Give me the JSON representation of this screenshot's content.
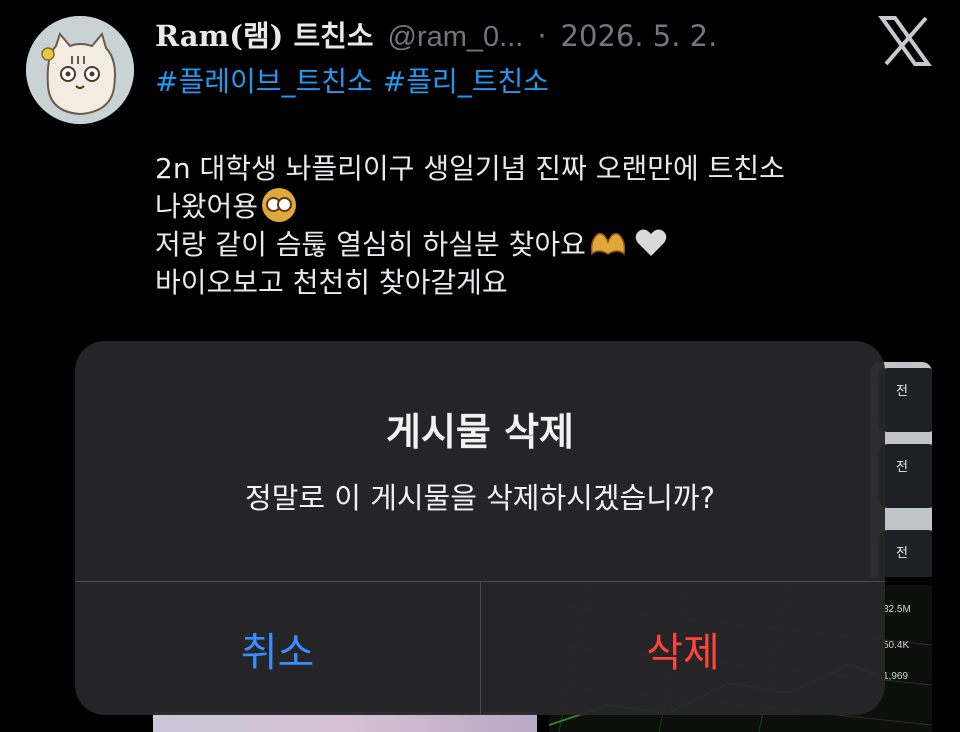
{
  "post": {
    "author_name": "Ram(램) 트친소",
    "handle": "@ram_0...",
    "separator": "·",
    "date": "2026. 5. 2.",
    "hashtags": [
      "#플레이브_트친소",
      "#플리_트친소"
    ],
    "body_lines": [
      "2n 대학생 놔플리이구 생일기념 진짜 오랜만에 트친소",
      "나왔어용",
      " 저랑 같이 슴툲 열심히 하실분 찾아요",
      "바이오보고 천천히 찾아갈게요"
    ],
    "emojis": [
      "flushed-face",
      "heart-hands",
      "white-heart"
    ]
  },
  "background_media": {
    "side_labels": [
      "전",
      "전",
      "전"
    ],
    "chart_numbers": [
      "32.5M",
      "50.4K",
      "1,969"
    ]
  },
  "dialog": {
    "title": "게시물 삭제",
    "message": "정말로 이 게시물을 삭제하시겠습니까?",
    "cancel_label": "취소",
    "delete_label": "삭제"
  },
  "colors": {
    "background": "#000000",
    "hashtag": "#1d9bf0",
    "cancel": "#3a8dff",
    "destructive": "#ff453a",
    "dialog": "#272729"
  }
}
